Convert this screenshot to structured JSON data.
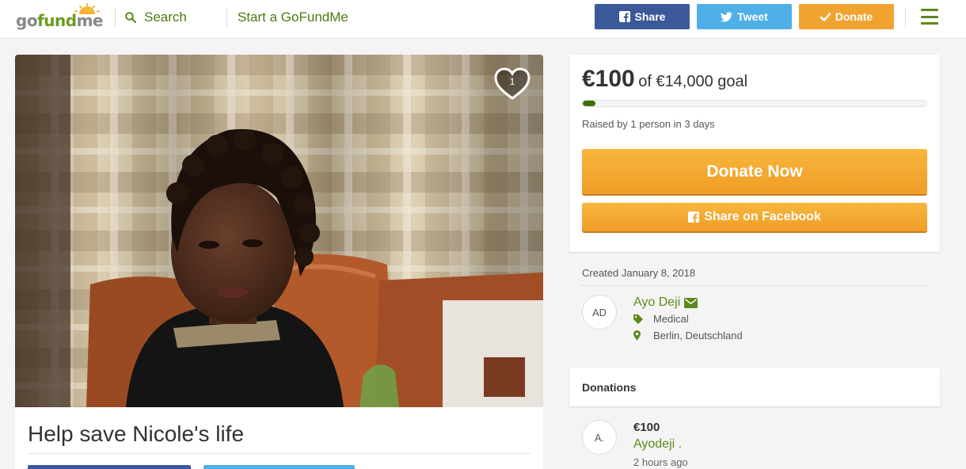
{
  "header": {
    "logo_parts": [
      "go",
      "fund",
      "me"
    ],
    "search_label": "Search",
    "start_label": "Start a GoFundMe",
    "share_label": "Share",
    "tweet_label": "Tweet",
    "donate_label": "Donate",
    "colors": {
      "facebook": "#3b5998",
      "twitter": "#4fb0e8",
      "donate": "#f1a331",
      "brand_green": "#6c9b1e"
    }
  },
  "campaign": {
    "title": "Help save Nicole's life",
    "heart_count": "1"
  },
  "goal": {
    "raised": "€100",
    "goal_text": "of €14,000 goal",
    "progress_fraction": 0.007,
    "raised_by": "Raised by 1 person in 3 days",
    "donate_now_label": "Donate Now",
    "share_facebook_label": "Share on Facebook"
  },
  "organizer": {
    "created": "Created January 8, 2018",
    "initials": "AD",
    "name": "Ayo Deji",
    "category": "Medical",
    "location": "Berlin, Deutschland"
  },
  "donations": {
    "heading": "Donations",
    "items": [
      {
        "initials": "A.",
        "amount": "€100",
        "name": "Ayodeji .",
        "time": "2 hours ago"
      }
    ]
  }
}
